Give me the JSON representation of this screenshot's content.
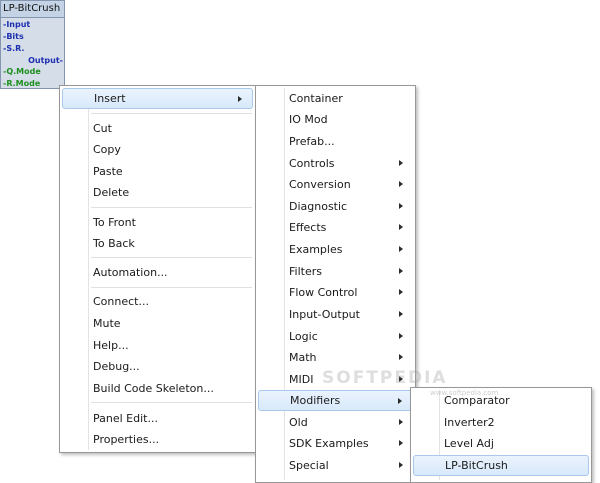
{
  "module": {
    "title": "LP-BitCrush",
    "inputs": [
      "-Input",
      "-Bits",
      "-S.R."
    ],
    "output": "Output-",
    "modes": [
      "-Q.Mode",
      "-R.Mode"
    ]
  },
  "context_menu": {
    "insert": "Insert",
    "cut": "Cut",
    "copy": "Copy",
    "paste": "Paste",
    "delete": "Delete",
    "to_front": "To Front",
    "to_back": "To Back",
    "automation": "Automation...",
    "connect": "Connect...",
    "mute": "Mute",
    "help": "Help...",
    "debug": "Debug...",
    "build_code_skeleton": "Build Code Skeleton...",
    "panel_edit": "Panel Edit...",
    "properties": "Properties..."
  },
  "insert_menu": {
    "container": "Container",
    "io_mod": "IO Mod",
    "prefab": "Prefab...",
    "controls": "Controls",
    "conversion": "Conversion",
    "diagnostic": "Diagnostic",
    "effects": "Effects",
    "examples": "Examples",
    "filters": "Filters",
    "flow_control": "Flow Control",
    "input_output": "Input-Output",
    "logic": "Logic",
    "math": "Math",
    "midi": "MIDI",
    "modifiers": "Modifiers",
    "old": "Old",
    "sdk_examples": "SDK Examples",
    "special": "Special"
  },
  "modifiers_menu": {
    "comparator": "Comparator",
    "inverter2": "Inverter2",
    "level_adj": "Level Adj",
    "lp_bitcrush": "LP-BitCrush"
  },
  "watermark": {
    "logo": "SOFTPEDIA",
    "url": "www.softpedia.com"
  },
  "colors": {
    "highlight_border": "#a8c8ec",
    "highlight_fill": "#d8e9fb",
    "module_fill": "#d4dde8",
    "pin_blue": "#1d2eb0",
    "pin_green": "#1f8f1f"
  }
}
